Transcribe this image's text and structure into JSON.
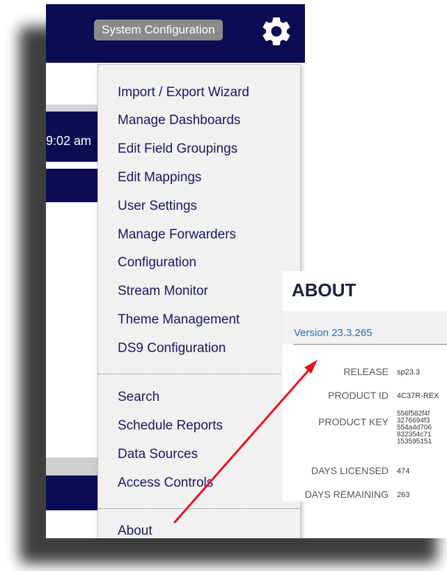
{
  "header": {
    "title": "System Configuration",
    "settings_icon": "gear-icon"
  },
  "background": {
    "time_text": "9:02 am"
  },
  "menu": {
    "group1": [
      {
        "label": "Import / Export Wizard"
      },
      {
        "label": "Manage Dashboards"
      },
      {
        "label": "Edit Field Groupings"
      },
      {
        "label": "Edit Mappings"
      },
      {
        "label": "User Settings"
      },
      {
        "label": "Manage Forwarders"
      },
      {
        "label": "Configuration"
      },
      {
        "label": "Stream Monitor"
      },
      {
        "label": "Theme Management"
      },
      {
        "label": "DS9 Configuration"
      }
    ],
    "group2": [
      {
        "label": "Search"
      },
      {
        "label": "Schedule Reports"
      },
      {
        "label": "Data Sources"
      },
      {
        "label": "Access Controls"
      }
    ],
    "group3": [
      {
        "label": "About"
      }
    ]
  },
  "about": {
    "title": "ABOUT",
    "version": "Version 23.3.265",
    "rows": {
      "release": {
        "key": "RELEASE",
        "value": "sp23.3"
      },
      "product_id": {
        "key": "PRODUCT ID",
        "value": "4C37R-REX"
      },
      "product_key": {
        "key": "PRODUCT KEY",
        "lines": [
          "556f582f4f",
          "3276694f3",
          "554a4d706",
          "832354c71",
          "153595151"
        ]
      },
      "days_licensed": {
        "key": "DAYS LICENSED",
        "value": "474"
      },
      "days_remaining": {
        "key": "DAYS REMAINING",
        "value": "263"
      }
    }
  },
  "colors": {
    "navy": "#0c0c52",
    "menu_text": "#17175f",
    "version_link": "#2c6cb0",
    "annotation_arrow": "#e8101a"
  }
}
